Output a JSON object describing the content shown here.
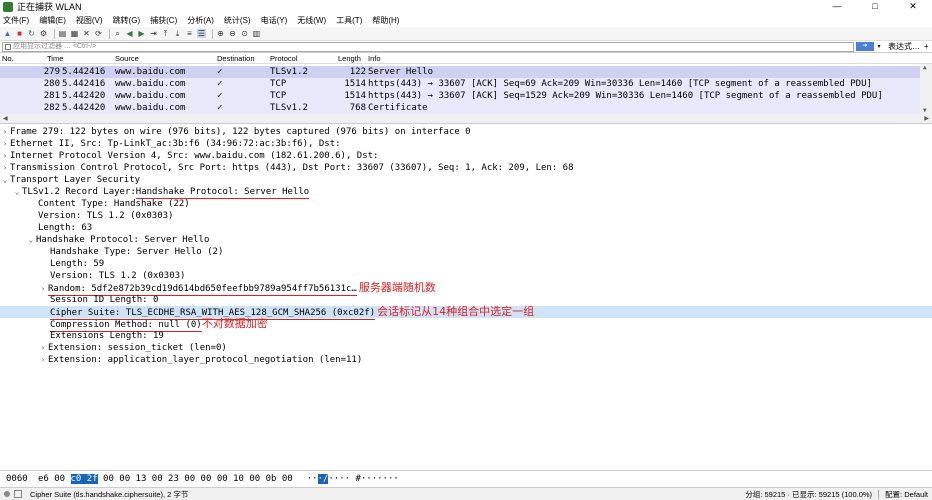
{
  "window": {
    "title": "正在捕获 WLAN",
    "min": "—",
    "max": "□",
    "close": "✕"
  },
  "menu": [
    "文件(F)",
    "编辑(E)",
    "视图(V)",
    "跳转(G)",
    "捕获(C)",
    "分析(A)",
    "统计(S)",
    "电话(Y)",
    "无线(W)",
    "工具(T)",
    "帮助(H)"
  ],
  "filter": {
    "placeholder": "应用显示过滤器 … <Ctrl-/>",
    "expression_label": "表达式…",
    "add": "+"
  },
  "packet_list": {
    "columns": {
      "no": "No.",
      "time": "Time",
      "source": "Source",
      "destination": "Destination",
      "protocol": "Protocol",
      "length": "Length",
      "info": "Info"
    },
    "rows": [
      {
        "no": "279",
        "time": "5.442416",
        "source": "www.baidu.com",
        "dst": "✓",
        "proto": "TLSv1.2",
        "len": "122",
        "info": "Server Hello"
      },
      {
        "no": "280",
        "time": "5.442416",
        "source": "www.baidu.com",
        "dst": "✓",
        "proto": "TCP",
        "len": "1514",
        "info": "https(443) → 33607 [ACK] Seq=69 Ack=209 Win=30336 Len=1460 [TCP segment of a reassembled PDU]"
      },
      {
        "no": "281",
        "time": "5.442420",
        "source": "www.baidu.com",
        "dst": "✓",
        "proto": "TCP",
        "len": "1514",
        "info": "https(443) → 33607 [ACK] Seq=1529 Ack=209 Win=30336 Len=1460 [TCP segment of a reassembled PDU]"
      },
      {
        "no": "282",
        "time": "5.442420",
        "source": "www.baidu.com",
        "dst": "✓",
        "proto": "TLSv1.2",
        "len": "768",
        "info": "Certificate"
      }
    ]
  },
  "details": {
    "frame": "Frame 279: 122 bytes on wire (976 bits), 122 bytes captured (976 bits) on interface 0",
    "ethernet": "Ethernet II, Src: Tp-LinkT_ac:3b:f6 (34:96:72:ac:3b:f6), Dst:",
    "ip": "Internet Protocol Version 4, Src: www.baidu.com (182.61.200.6), Dst:",
    "tcp": "Transmission Control Protocol, Src Port: https (443), Dst Port: 33607 (33607), Seq: 1, Ack: 209, Len: 68",
    "tls": "Transport Layer Security",
    "record_prefix": "TLSv1.2 Record Layer: ",
    "record_highlight": "Handshake Protocol: Server Hello",
    "content_type": "Content Type: Handshake (22)",
    "version": "Version: TLS 1.2 (0x0303)",
    "length": "Length: 63",
    "hs_protocol": "Handshake Protocol: Server Hello",
    "hs_type": "Handshake Type: Server Hello (2)",
    "hs_length": "Length: 59",
    "hs_version": "Version: TLS 1.2 (0x0303)",
    "random": "Random: 5df2e872b39cd19d614bd650feefbb9789a954ff7b56131c…",
    "random_annot": "服务器端随机数",
    "session_id_len": "Session ID Length: 0",
    "cipher": "Cipher Suite: TLS_ECDHE_RSA_WITH_AES_128_GCM_SHA256 (0xc02f)",
    "cipher_annot": "会话标记从14种组合中选定一组",
    "compression": "Compression Method: null (0)",
    "compression_annot": "不对数据加密",
    "ext_length": "Extensions Length: 19",
    "ext_session": "Extension: session_ticket (len=0)",
    "ext_alpn": "Extension: application_layer_protocol_negotiation (len=11)"
  },
  "bytes": {
    "offset": "0060",
    "hex_before": "e6 00 ",
    "hex_sel": "c0 2f",
    "hex_after": " 00 00 13 00   23 00 00 00 10 00 0b 00",
    "ascii_before": "··",
    "ascii_sel": "·/",
    "ascii_after": "····  #·······"
  },
  "status": {
    "field": "Cipher Suite (tls.handshake.ciphersuite), 2 字节",
    "packets": "分组: 59215 · 已显示: 59215 (100.0%)",
    "profile": "配置: Default"
  }
}
